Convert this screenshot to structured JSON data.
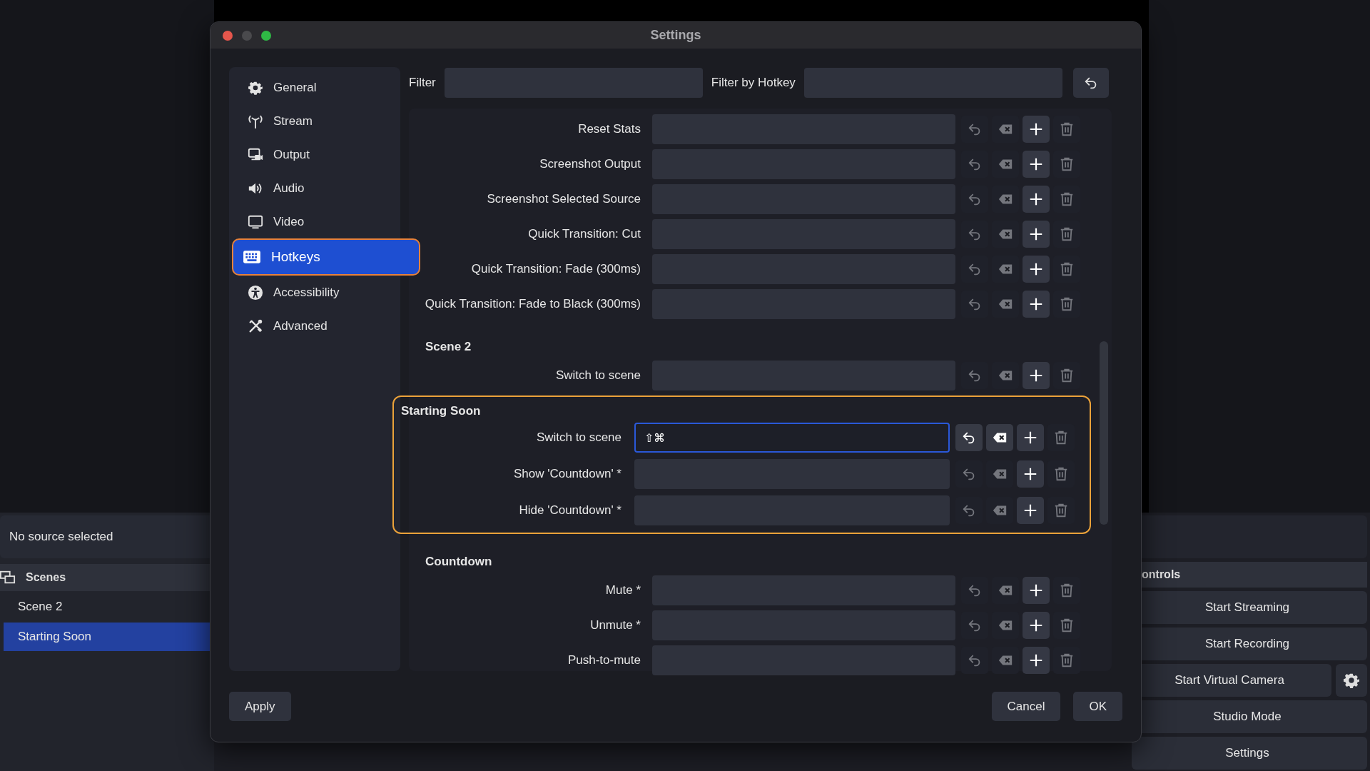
{
  "main": {
    "source_bar": "No source selected",
    "scenes": {
      "title": "Scenes",
      "items": [
        {
          "label": "Scene 2",
          "selected": false
        },
        {
          "label": "Starting Soon",
          "selected": true
        }
      ]
    },
    "controls": {
      "title": "ontrols",
      "buttons": [
        "Start Streaming",
        "Start Recording",
        "Start Virtual Camera",
        "Studio Mode",
        "Settings"
      ]
    }
  },
  "window": {
    "title": "Settings"
  },
  "sidebar": {
    "items": [
      {
        "label": "General",
        "selected": false
      },
      {
        "label": "Stream",
        "selected": false
      },
      {
        "label": "Output",
        "selected": false
      },
      {
        "label": "Audio",
        "selected": false
      },
      {
        "label": "Video",
        "selected": false
      },
      {
        "label": "Hotkeys",
        "selected": true
      },
      {
        "label": "Accessibility",
        "selected": false
      },
      {
        "label": "Advanced",
        "selected": false
      }
    ]
  },
  "filter": {
    "label": "Filter"
  },
  "filter_by_hotkey": {
    "label": "Filter by Hotkey"
  },
  "hotkeys": {
    "groups": [
      {
        "highlighted": false,
        "rows": [
          {
            "label": "Reset Stats",
            "focused": false
          },
          {
            "label": "Screenshot Output",
            "focused": false
          },
          {
            "label": "Screenshot Selected Source",
            "focused": false
          },
          {
            "label": "Quick Transition: Cut",
            "focused": false
          },
          {
            "label": "Quick Transition: Fade (300ms)",
            "focused": false
          },
          {
            "label": "Quick Transition: Fade to Black (300ms)",
            "focused": false
          }
        ]
      },
      {
        "title": "Scene 2",
        "highlighted": false,
        "rows": [
          {
            "label": "Switch to scene",
            "focused": false
          }
        ]
      },
      {
        "title": "Starting Soon",
        "highlighted": true,
        "rows": [
          {
            "label": "Switch to scene",
            "value": "⇧⌘",
            "focused": true
          },
          {
            "label": "Show 'Countdown' *",
            "focused": false
          },
          {
            "label": "Hide 'Countdown' *",
            "focused": false
          }
        ]
      },
      {
        "title": "Countdown",
        "highlighted": false,
        "rows": [
          {
            "label": "Mute *",
            "focused": false
          },
          {
            "label": "Unmute *",
            "focused": false
          },
          {
            "label": "Push-to-mute",
            "focused": false
          }
        ]
      }
    ]
  },
  "buttons": {
    "apply": "Apply",
    "cancel": "Cancel",
    "ok": "OK"
  }
}
